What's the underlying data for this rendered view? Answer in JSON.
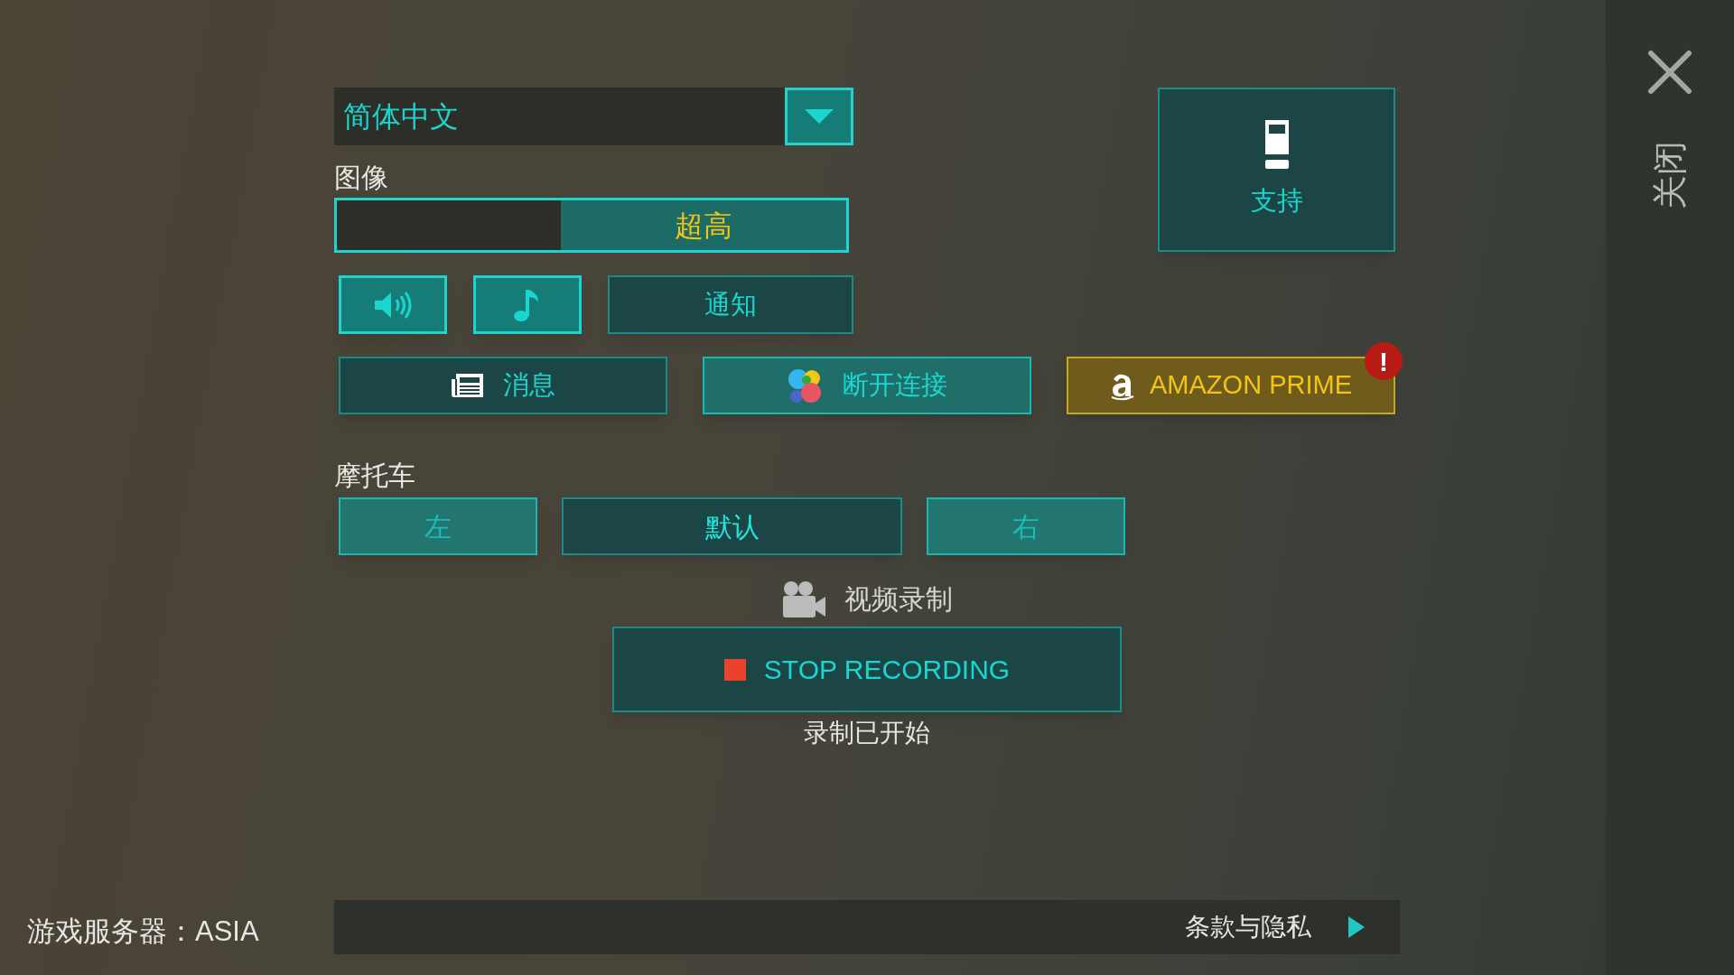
{
  "language": {
    "value": "简体中文"
  },
  "graphics": {
    "label": "图像",
    "value": "超高",
    "level": 0.56
  },
  "audio_buttons": [
    {
      "kind": "sound",
      "on": true
    },
    {
      "kind": "music",
      "on": true
    },
    {
      "kind": "text",
      "label": "通知",
      "on": false
    }
  ],
  "action_buttons": [
    {
      "kind": "news",
      "label": "消息"
    },
    {
      "kind": "connect",
      "label": "断开连接"
    },
    {
      "kind": "amazon",
      "label": "AMAZON PRIME",
      "alert": "!"
    }
  ],
  "support": {
    "label": "支持"
  },
  "close": {
    "label": "关闭"
  },
  "motorcycle": {
    "label": "摩托车",
    "options": [
      {
        "label": "左",
        "selected": false
      },
      {
        "label": "默认",
        "selected": true
      },
      {
        "label": "右",
        "selected": false
      }
    ]
  },
  "recording": {
    "title": "视频录制",
    "button": "STOP RECORDING",
    "status": "录制已开始"
  },
  "footer": {
    "server": "游戏服务器：ASIA",
    "terms": "条款与隐私"
  }
}
